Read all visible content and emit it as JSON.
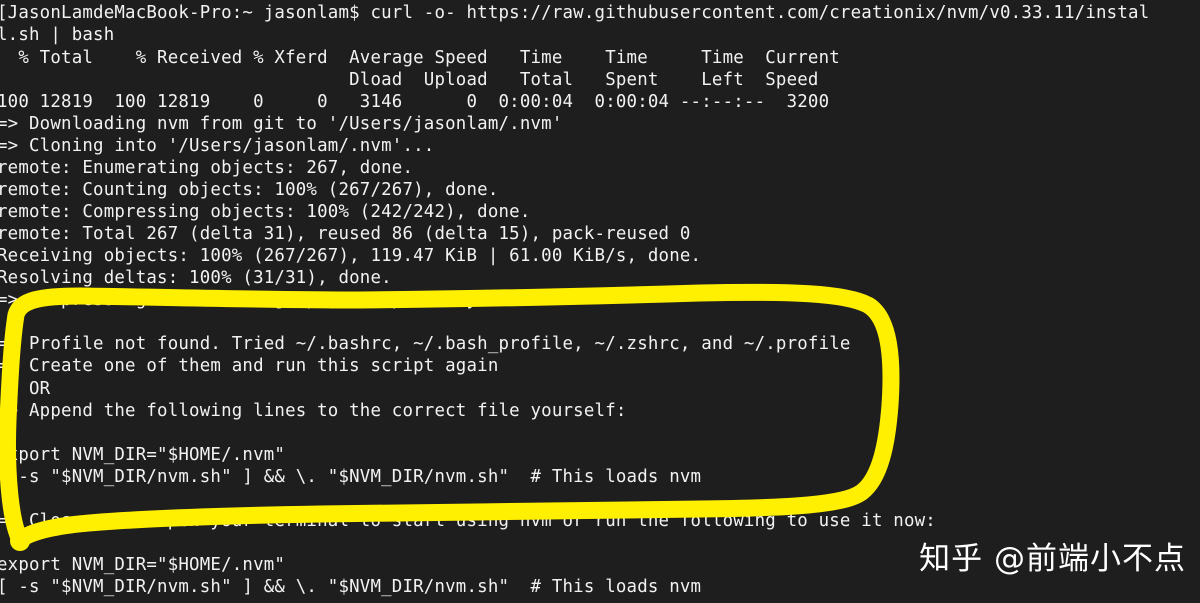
{
  "terminal": {
    "background_color": "#1e1e1e",
    "text_color": "#f2f2f2",
    "prompt": "[JasonLamdeMacBook-Pro:~ jasonlam$ ",
    "command": "curl -o- https://raw.githubusercontent.com/creationix/nvm/v0.33.11/install.sh | bash",
    "lines": [
      "[JasonLamdeMacBook-Pro:~ jasonlam$ curl -o- https://raw.githubusercontent.com/creationix/nvm/v0.33.11/instal",
      "l.sh | bash",
      "  % Total    % Received % Xferd  Average Speed   Time    Time     Time  Current",
      "                                 Dload  Upload   Total   Spent    Left  Speed",
      "100 12819  100 12819    0     0   3146      0  0:00:04  0:00:04 --:--:--  3200",
      "=> Downloading nvm from git to '/Users/jasonlam/.nvm'",
      "=> Cloning into '/Users/jasonlam/.nvm'...",
      "remote: Enumerating objects: 267, done.",
      "remote: Counting objects: 100% (267/267), done.",
      "remote: Compressing objects: 100% (242/242), done.",
      "remote: Total 267 (delta 31), reused 86 (delta 15), pack-reused 0",
      "Receiving objects: 100% (267/267), 119.47 KiB | 61.00 KiB/s, done.",
      "Resolving deltas: 100% (31/31), done.",
      "=> Compressing and cleaning up git repository",
      "",
      "=> Profile not found. Tried ~/.bashrc, ~/.bash_profile, ~/.zshrc, and ~/.profile",
      "=> Create one of them and run this script again",
      "   OR",
      "=> Append the following lines to the correct file yourself:",
      "",
      "export NVM_DIR=\"$HOME/.nvm\"",
      "[ -s \"$NVM_DIR/nvm.sh\" ] && \\. \"$NVM_DIR/nvm.sh\"  # This loads nvm",
      "",
      "=> Close and reopen your terminal to start using nvm or run the following to use it now:",
      "",
      "export NVM_DIR=\"$HOME/.nvm\"",
      "[ -s \"$NVM_DIR/nvm.sh\" ] && \\. \"$NVM_DIR/nvm.sh\"  # This loads nvm"
    ]
  },
  "annotation": {
    "type": "hand-drawn-circle-highlight",
    "color": "#ffef00",
    "stroke_width": 17,
    "encircles": "profile-not-found-instructions"
  },
  "watermark": {
    "text": "知乎 @前端小不点",
    "color": "#ffffff"
  }
}
